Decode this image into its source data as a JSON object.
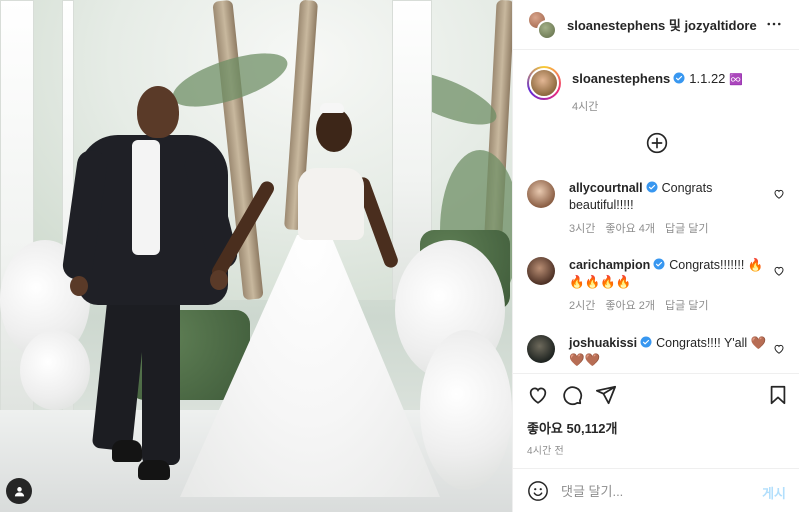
{
  "header": {
    "title": "sloanestephens 및 jozyaltidore",
    "more_icon": "more-horizontal-icon"
  },
  "caption": {
    "username": "sloanestephens",
    "text": "1.1.22",
    "emoji": "♾️",
    "time": "4시간"
  },
  "load_more_icon": "plus-circle-icon",
  "comments": [
    {
      "username": "allycourtnall",
      "text": "Congrats beautiful!!!!!",
      "time": "3시간",
      "likes": "좋아요 4개",
      "reply": "답글 달기"
    },
    {
      "username": "carichampion",
      "text": "Congrats!!!!!!! 🔥🔥🔥🔥🔥",
      "time": "2시간",
      "likes": "좋아요 2개",
      "reply": "답글 달기"
    },
    {
      "username": "joshuakissi",
      "text": "Congrats!!!! Y'all 🤎🤎🤎"
    }
  ],
  "actions": {
    "like_icon": "heart-icon",
    "comment_icon": "comment-icon",
    "share_icon": "send-icon",
    "save_icon": "bookmark-icon"
  },
  "likes_count": "좋아요 50,112개",
  "post_time": "4시간 전",
  "comment_box": {
    "placeholder": "댓글 달기...",
    "post_label": "게시"
  },
  "colors": {
    "verified": "#3897f0",
    "muted_text": "#8e8e8e",
    "post_button": "#b2dffc"
  }
}
